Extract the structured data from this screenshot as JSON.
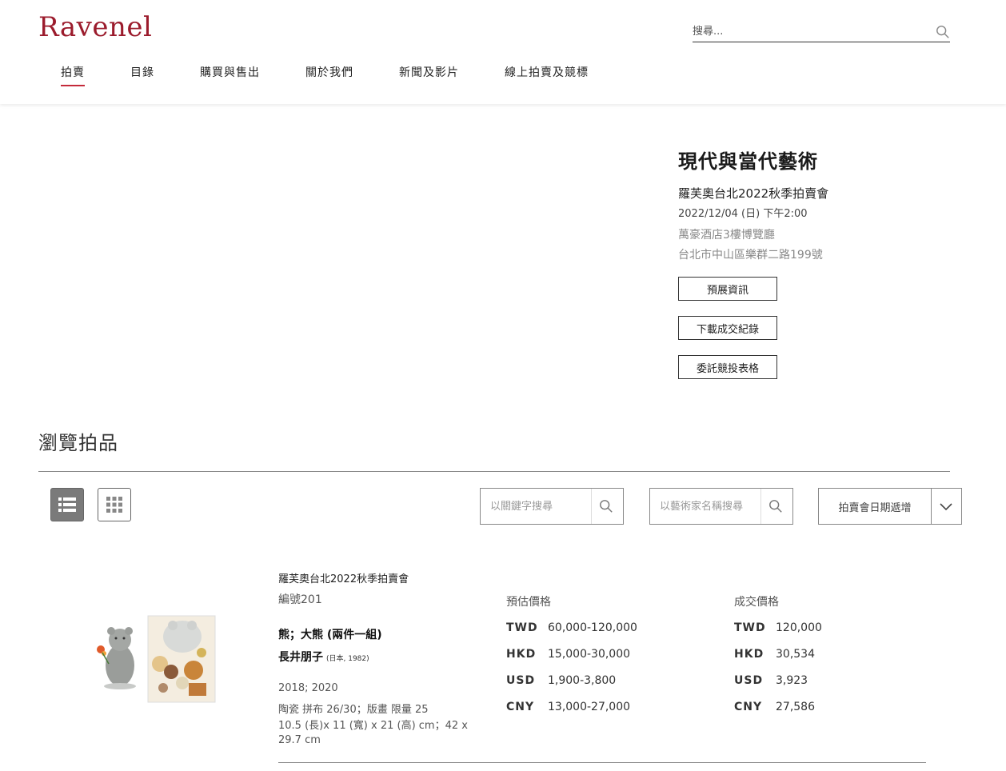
{
  "header": {
    "logo": "Ravenel",
    "search_placeholder": "搜尋...",
    "nav": [
      {
        "label": "拍賣",
        "active": true
      },
      {
        "label": "目錄"
      },
      {
        "label": "購買與售出"
      },
      {
        "label": "關於我們"
      },
      {
        "label": "新聞及影片"
      },
      {
        "label": "線上拍賣及競標"
      }
    ]
  },
  "sale": {
    "title": "現代與當代藝術",
    "name": "羅芙奧台北2022秋季拍賣會",
    "date": "2022/12/04 (日) 下午2:00",
    "venue": "萬豪酒店3樓博覽廳",
    "address": "台北市中山區樂群二路199號",
    "buttons": [
      "預展資訊",
      "下載成交紀錄",
      "委託競投表格"
    ]
  },
  "browse": {
    "title": "瀏覽拍品",
    "keyword_placeholder": "以關鍵字搜尋",
    "artist_placeholder": "以藝術家名稱搜尋",
    "sort_label": "拍賣會日期遞增"
  },
  "lot": {
    "sale": "羅芙奧台北2022秋季拍賣會",
    "number": "編號201",
    "title": "熊；大熊 (兩件一組)",
    "artist": "長井朋子",
    "artist_meta": "(日本, 1982)",
    "year": "2018; 2020",
    "medium": "陶瓷 拼布 26/30；版畫 限量 25",
    "dimensions": "10.5 (長)x 11 (寬) x 21 (高) cm；42 x 29.7 cm",
    "estimate_label": "預估價格",
    "sold_label": "成交價格",
    "estimate": [
      {
        "currency": "TWD",
        "value": "60,000-120,000"
      },
      {
        "currency": "HKD",
        "value": "15,000-30,000"
      },
      {
        "currency": "USD",
        "value": "1,900-3,800"
      },
      {
        "currency": "CNY",
        "value": "13,000-27,000"
      }
    ],
    "sold": [
      {
        "currency": "TWD",
        "value": "120,000"
      },
      {
        "currency": "HKD",
        "value": "30,534"
      },
      {
        "currency": "USD",
        "value": "3,923"
      },
      {
        "currency": "CNY",
        "value": "27,586"
      }
    ]
  },
  "colors": {
    "brand": "#9b1b2c",
    "nav_active_underline": "#c42a3a"
  }
}
